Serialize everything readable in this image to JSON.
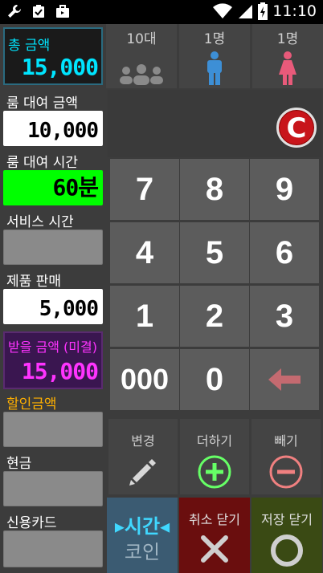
{
  "status_bar": {
    "time": "11:10"
  },
  "left": {
    "total": {
      "label": "총 금액",
      "value": "15,000"
    },
    "room_amount": {
      "label": "룸 대여 금액",
      "value": "10,000"
    },
    "room_time": {
      "label": "룸 대여 시간",
      "value": "60분"
    },
    "service_time": {
      "label": "서비스 시간",
      "value": ""
    },
    "product_sales": {
      "label": "제품 판매",
      "value": "5,000"
    },
    "receive": {
      "label": "받을 금액 (미결)",
      "value": "15,000"
    },
    "discount": {
      "label": "할인금액",
      "value": ""
    },
    "cash": {
      "label": "현금",
      "value": ""
    },
    "card": {
      "label": "신용카드",
      "value": ""
    }
  },
  "people": [
    {
      "label": "10대",
      "icon": "group-icon"
    },
    {
      "label": "1명",
      "icon": "male-icon"
    },
    {
      "label": "1명",
      "icon": "female-icon"
    }
  ],
  "clear_label": "C",
  "keypad": [
    "7",
    "8",
    "9",
    "4",
    "5",
    "6",
    "1",
    "2",
    "3",
    "000",
    "0"
  ],
  "ops": {
    "change": "변경",
    "add": "더하기",
    "subtract": "빼기"
  },
  "bottom": {
    "time_top": "▸시간◂",
    "time_bottom": "코인",
    "cancel": "취소 닫기",
    "save": "저장 닫기"
  },
  "colors": {
    "cyan": "#00e5ff",
    "magenta": "#ff33ff",
    "green": "#00ff00",
    "orange": "#ffb000",
    "red": "#c8151b"
  }
}
